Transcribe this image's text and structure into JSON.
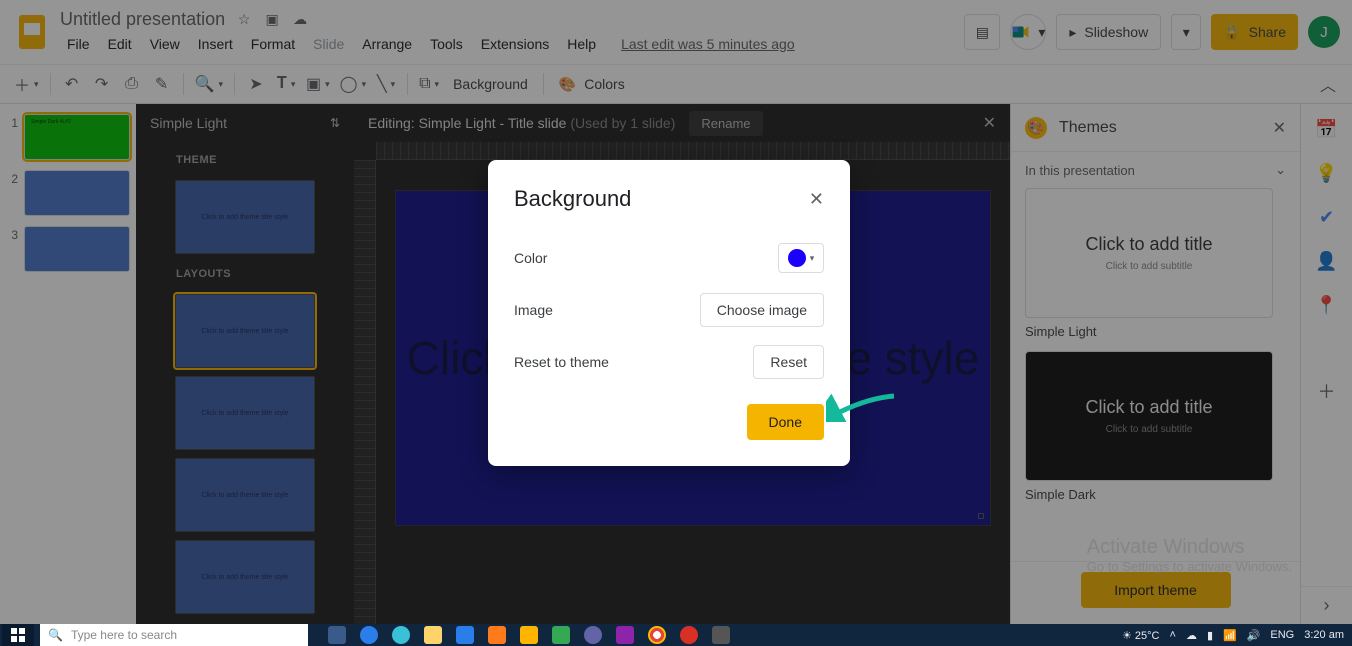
{
  "header": {
    "doc_title": "Untitled presentation",
    "menus": [
      "File",
      "Edit",
      "View",
      "Insert",
      "Format",
      "Slide",
      "Arrange",
      "Tools",
      "Extensions",
      "Help"
    ],
    "disabled_menu_index": 5,
    "last_edit": "Last edit was 5 minutes ago",
    "slideshow": "Slideshow",
    "share": "Share",
    "avatar_initial": "J"
  },
  "toolbar": {
    "background": "Background",
    "colors": "Colors"
  },
  "filmstrip": {
    "slides": [
      {
        "num": "1",
        "style": "green",
        "selected": true,
        "label": "Simple Dark #L#2"
      },
      {
        "num": "2",
        "style": "blue",
        "selected": false
      },
      {
        "num": "3",
        "style": "blue",
        "selected": false
      }
    ]
  },
  "theme_panel": {
    "name": "Simple Light",
    "section_theme": "THEME",
    "section_layouts": "LAYOUTS",
    "placeholder": "Click to add theme title style"
  },
  "canvas": {
    "editing_prefix": "Editing: ",
    "editing_name": "Simple Light - Title slide",
    "used_by": "(Used by 1 slide)",
    "rename": "Rename",
    "slide_text": "Click to add theme title style"
  },
  "themes_side": {
    "title": "Themes",
    "section": "In this presentation",
    "thumbs": [
      {
        "title": "Click to add title",
        "subtitle": "Click to add subtitle",
        "name": "Simple Light",
        "dark": false
      },
      {
        "title": "Click to add title",
        "subtitle": "Click to add subtitle",
        "name": "Simple Dark",
        "dark": true
      }
    ],
    "import": "Import theme"
  },
  "dialog": {
    "title": "Background",
    "color_label": "Color",
    "color_value": "#1a00ff",
    "image_label": "Image",
    "choose_image": "Choose image",
    "reset_label": "Reset to theme",
    "reset": "Reset",
    "done": "Done"
  },
  "watermark": {
    "line1": "Activate Windows",
    "line2": "Go to Settings to activate Windows."
  },
  "taskbar": {
    "search_placeholder": "Type here to search",
    "temp": "25°C",
    "lang": "ENG",
    "time": "3:20 am"
  }
}
